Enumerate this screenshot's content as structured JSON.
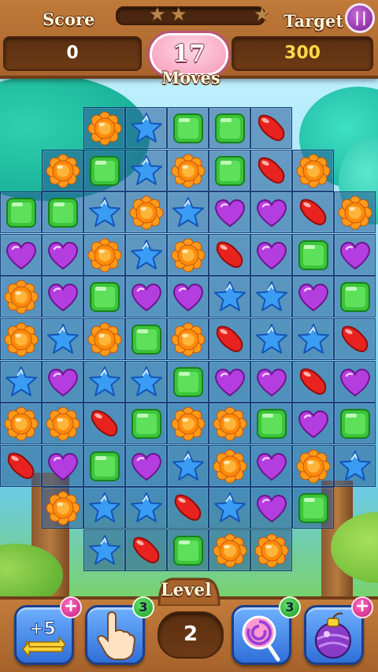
{
  "hud": {
    "score_label": "Score",
    "score_value": "0",
    "target_label": "Target",
    "target_value": "300",
    "moves_value": "17",
    "moves_label": "Moves",
    "stars_total": 3,
    "stars_earned": 0,
    "score_progress": 0
  },
  "footer": {
    "level_label": "Level",
    "level_value": "2",
    "boosters": [
      {
        "name": "plus-five-moves",
        "icon": "plus-five-swap-icon",
        "text": "+5",
        "badge": "plus"
      },
      {
        "name": "hand",
        "icon": "pointing-hand-icon",
        "badge": "3"
      },
      {
        "name": "lollipop",
        "icon": "lollipop-icon",
        "badge": "3"
      },
      {
        "name": "bomb",
        "icon": "purple-bomb-icon",
        "badge": "plus"
      }
    ]
  },
  "board": {
    "columns": 9,
    "rows": 11,
    "legend": {
      "O": "orange-flower-candy",
      "B": "blue-star-candy",
      "G": "green-square-candy",
      "R": "red-bean-candy",
      "P": "purple-heart-candy",
      ".": "empty"
    },
    "grid": [
      ". . O B G G R . .",
      ". O G B O G R O .",
      "G G B O B P P R O",
      "P P O B O R P G P",
      "O P G P P B B P G",
      "O B O G O R B B R",
      "B P B B G P P R P",
      "O O R G O O G P G",
      "R P G P B O P O B",
      ". O B B R B P G .",
      ". . B R G O O . ."
    ]
  },
  "colors": {
    "wood": "#a7632b",
    "board_cell": "#2f6aa8",
    "moves_pill": "#f59ab8",
    "pause": "#8e2aa8"
  }
}
